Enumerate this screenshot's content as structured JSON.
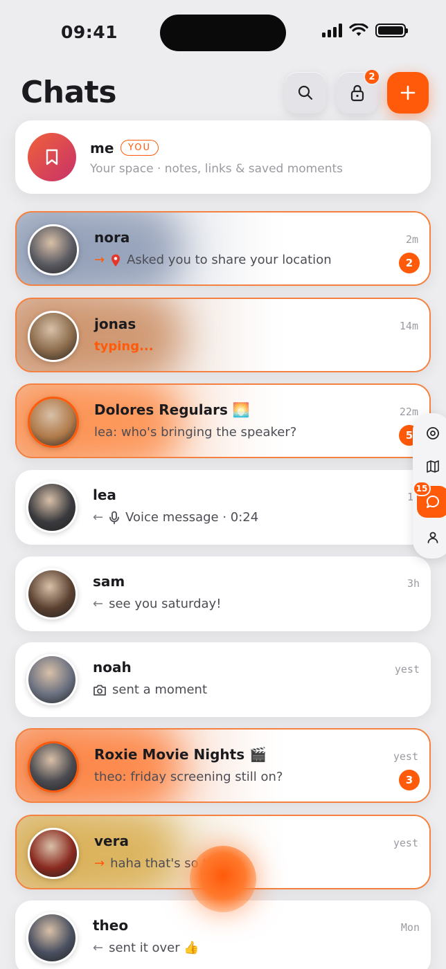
{
  "status_bar": {
    "time": "09:41"
  },
  "header": {
    "title": "Chats",
    "lock_badge": "2"
  },
  "me_card": {
    "name": "me",
    "badge": "YOU",
    "subtitle": "Your space · notes, links & saved moments"
  },
  "chats": [
    {
      "name": "nora",
      "preview": "Asked you to share your location",
      "time": "2m",
      "unread": "2",
      "direction": "out",
      "icon": "pin",
      "hot": true,
      "glow": "#7a8aa8",
      "avatar_color": "#5a5a62"
    },
    {
      "name": "jonas",
      "preview": "typing...",
      "time": "14m",
      "unread": "",
      "direction": "",
      "icon": "",
      "hot": true,
      "glow": "#c47c4a",
      "avatar_color": "#8a6a4a"
    },
    {
      "name": "Dolores Regulars 🌅",
      "preview": "lea: who's bringing the speaker?",
      "time": "22m",
      "unread": "5",
      "direction": "",
      "icon": "",
      "hot": true,
      "glow": "#ff7a2a",
      "avatar_color": "#b07a4a"
    },
    {
      "name": "lea",
      "preview": "Voice message · 0:24",
      "time": "1h",
      "unread": "",
      "direction": "in",
      "icon": "mic",
      "hot": false,
      "glow": "",
      "avatar_color": "#3a3a3e"
    },
    {
      "name": "sam",
      "preview": "see you saturday!",
      "time": "3h",
      "unread": "",
      "direction": "in",
      "icon": "",
      "hot": false,
      "glow": "",
      "avatar_color": "#5a4030"
    },
    {
      "name": "noah",
      "preview": "sent a moment",
      "time": "yest",
      "unread": "",
      "direction": "",
      "icon": "camera",
      "hot": false,
      "glow": "",
      "avatar_color": "#6a7080"
    },
    {
      "name": "Roxie Movie Nights 🎬",
      "preview": "theo: friday screening still on?",
      "time": "yest",
      "unread": "3",
      "direction": "",
      "icon": "",
      "hot": true,
      "glow": "#ff6a1a",
      "avatar_color": "#4a4a50"
    },
    {
      "name": "vera",
      "preview": "haha that's so true",
      "time": "yest",
      "unread": "",
      "direction": "out",
      "icon": "",
      "hot": true,
      "glow": "#d4a030",
      "avatar_color": "#8a2a20"
    },
    {
      "name": "theo",
      "preview": "sent it over 👍",
      "time": "Mon",
      "unread": "",
      "direction": "in",
      "icon": "",
      "hot": false,
      "glow": "",
      "avatar_color": "#4a5060"
    }
  ],
  "side_rail": {
    "chat_badge": "15"
  },
  "colors": {
    "accent": "#ff5a0a",
    "background": "#ededf0"
  }
}
